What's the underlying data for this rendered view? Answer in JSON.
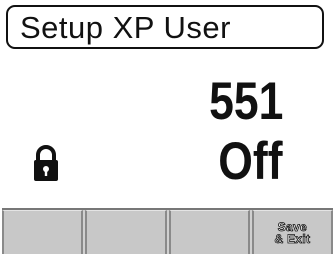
{
  "screen": {
    "title": "Setup XP User",
    "value_primary": "551",
    "value_secondary": "Off"
  },
  "icons": {
    "status": "lock-icon"
  },
  "softkeys": [
    {
      "label": ""
    },
    {
      "label": ""
    },
    {
      "label": ""
    },
    {
      "label_line1": "Save",
      "label_line2": "& Exit"
    }
  ]
}
